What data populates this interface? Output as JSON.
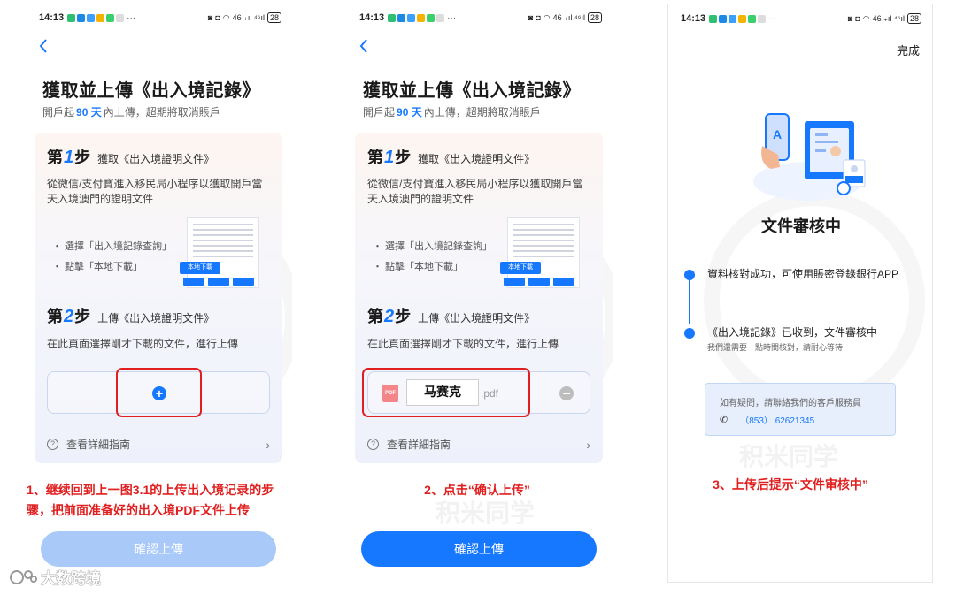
{
  "status_bar": {
    "time": "14:13",
    "dots": "···",
    "network": "46 ₊ıl ⁴⁶ıl",
    "battery": "28"
  },
  "panel1": {
    "title": "獲取並上傳《出入境記錄》",
    "subtitle_prefix": "開戶起",
    "subtitle_days": "90 天",
    "subtitle_suffix": "內上傳，超期將取消賬戶",
    "step1": {
      "di": "第",
      "num": "1",
      "bu": "步",
      "label": "獲取《出入境證明文件》",
      "desc": "從微信/支付寶進入移民局小程序以獲取開戶當天入境澳門的證明文件",
      "bullet1": "・ 選擇「出入境記錄查詢」",
      "bullet2": "・ 點擊「本地下載」",
      "img_btn": "本地下載"
    },
    "step2": {
      "di": "第",
      "num": "2",
      "bu": "步",
      "label": "上傳《出入境證明文件》",
      "desc": "在此頁面選擇剛才下載的文件，進行上傳"
    },
    "upload_plus": "+",
    "guide": "查看詳細指南",
    "note": "1、继续回到上一图3.1的上传出入境记录的步骤，把前面准备好的出入境PDF文件上传",
    "confirm": "確認上傳"
  },
  "panel2": {
    "title": "獲取並上傳《出入境記錄》",
    "subtitle_prefix": "開戶起",
    "subtitle_days": "90 天",
    "subtitle_suffix": "內上傳，超期將取消賬戶",
    "step1": {
      "di": "第",
      "num": "1",
      "bu": "步",
      "label": "獲取《出入境證明文件》",
      "desc": "從微信/支付寶進入移民局小程序以獲取開戶當天入境澳門的證明文件",
      "bullet1": "・ 選擇「出入境記錄查詢」",
      "bullet2": "・ 點擊「本地下載」",
      "img_btn": "本地下載"
    },
    "step2": {
      "di": "第",
      "num": "2",
      "bu": "步",
      "label": "上傳《出入境證明文件》",
      "desc": "在此頁面選擇剛才下載的文件，進行上傳"
    },
    "pdf_label": "PDF",
    "file_name": "马赛克",
    "file_ext": ".pdf",
    "guide": "查看詳細指南",
    "note": "2、点击“确认上传”",
    "confirm": "確認上傳"
  },
  "panel3": {
    "done": "完成",
    "review_title": "文件審核中",
    "item1": "資料核對成功，可使用賬密登錄銀行APP",
    "item2": "《出入境記錄》已收到，文件審核中",
    "item2_sub": "我們還需要一點時間核對，請耐心等待",
    "contact_label": "如有疑問，請聯絡我們的客戶服務員",
    "contact_code": "（853）",
    "contact_number": "62621345",
    "note": "3、上传后提示“文件审核中”"
  },
  "watermark": "积米同学",
  "brand": "大数跨境",
  "colors": {
    "accent": "#1677ff",
    "accent_disabled": "#a9c9f8",
    "annotation_red": "#e02020"
  }
}
